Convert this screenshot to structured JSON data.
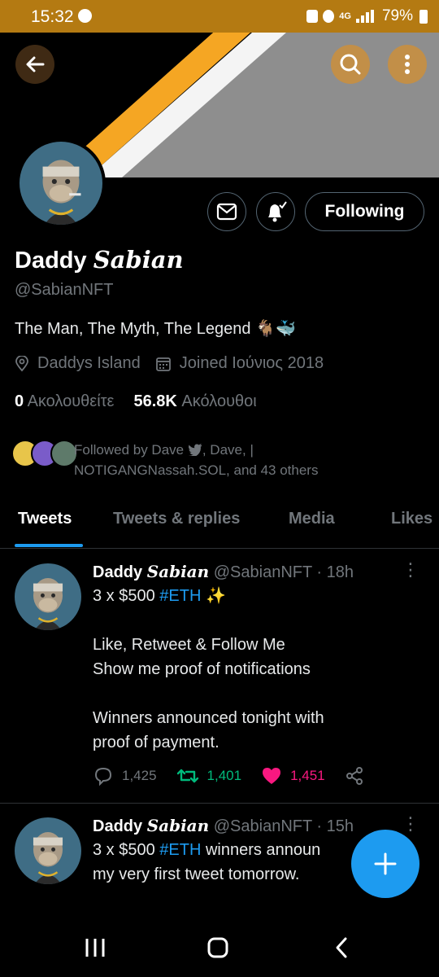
{
  "status_bar": {
    "time": "15:32",
    "battery": "79%",
    "network": "4G"
  },
  "profile": {
    "name_plain": "Daddy ",
    "name_styled": "Sabian",
    "handle": "@SabianNFT",
    "bio": "The Man, The Myth, The Legend",
    "bio_emoji": "🐐🐳",
    "location": "Daddys Island",
    "joined": "Joined Ιούνιος 2018",
    "following_count": "0",
    "following_label": "Ακολουθείτε",
    "followers_count": "56.8K",
    "followers_label": "Ακόλουθοι",
    "followed_by_line1": "Followed by Dave",
    "followed_by_line1b": ", Dave, |",
    "followed_by_line2": "NOTIGANGNassah.SOL, and 43 others"
  },
  "buttons": {
    "following": "Following"
  },
  "tabs": [
    {
      "label": "Tweets",
      "active": true
    },
    {
      "label": "Tweets & replies",
      "active": false
    },
    {
      "label": "Media",
      "active": false
    },
    {
      "label": "Likes",
      "active": false
    }
  ],
  "tweets": [
    {
      "name_plain": "Daddy ",
      "name_styled": "Sabian",
      "handle": "@SabianNFT",
      "time": "· 18h",
      "text_pre": "3 x $500 ",
      "hashtag": "#ETH",
      "text_post": " ✨",
      "body": "Like, Retweet & Follow Me\nShow me proof of notifications\n\nWinners announced tonight with\nproof of payment.",
      "replies": "1,425",
      "retweets": "1,401",
      "likes": "1,451"
    },
    {
      "name_plain": "Daddy ",
      "name_styled": "Sabian",
      "handle": "@SabianNFT",
      "time": "· 15h",
      "text_pre": "3 x $500 ",
      "hashtag": "#ETH",
      "text_post": " winners announ",
      "body": "my very first tweet tomorrow."
    }
  ],
  "colors": {
    "accent": "#1d9bf0",
    "retweet": "#00ba7c",
    "like": "#f91880",
    "status_bar": "#b47a12"
  },
  "icons": [
    "back-arrow-icon",
    "search-icon",
    "more-vertical-icon",
    "mail-icon",
    "bell-icon",
    "location-icon",
    "calendar-icon",
    "twitter-bird-icon",
    "reply-icon",
    "retweet-icon",
    "heart-icon",
    "share-icon",
    "compose-plus-icon"
  ]
}
